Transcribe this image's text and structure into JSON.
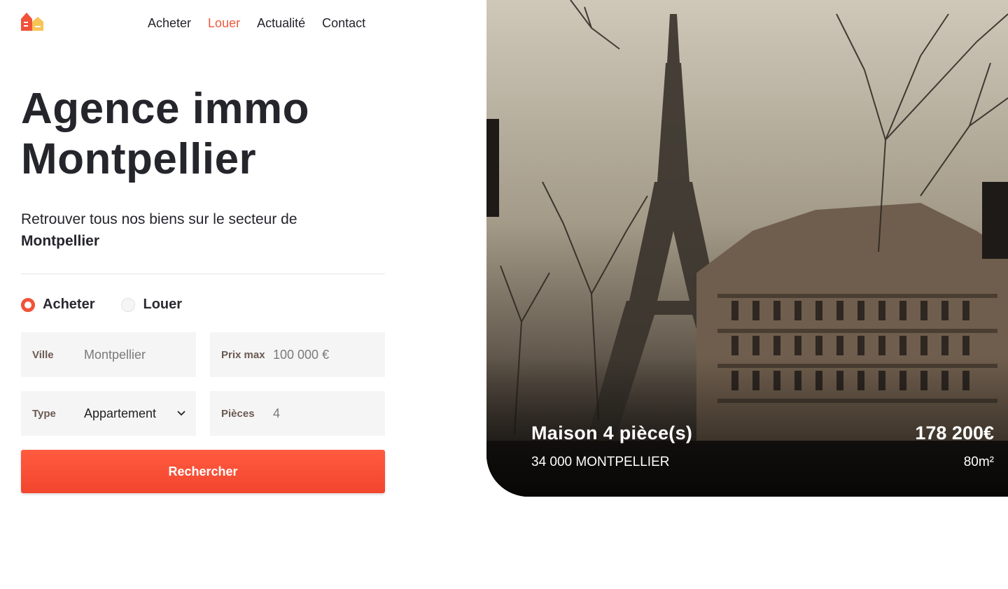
{
  "brand": {
    "logo_icon": "house-logo-icon",
    "accent": "#ee5a3e"
  },
  "nav": {
    "items": [
      {
        "label": "Acheter",
        "active": false
      },
      {
        "label": "Louer",
        "active": true
      },
      {
        "label": "Actualité",
        "active": false
      },
      {
        "label": "Contact",
        "active": false
      }
    ]
  },
  "hero": {
    "title_line1": "Agence immo",
    "title_line2": "Montpellier",
    "subtitle": "Retrouver tous nos biens sur le secteur de",
    "subtitle_strong": "Montpellier"
  },
  "search": {
    "mode_options": [
      {
        "label": "Acheter",
        "selected": true
      },
      {
        "label": "Louer",
        "selected": false
      }
    ],
    "ville": {
      "label": "Ville",
      "value": "Montpellier"
    },
    "prix": {
      "label": "Prix max",
      "value": "100 000 €"
    },
    "type": {
      "label": "Type",
      "value": "Appartement"
    },
    "pieces": {
      "label": "Pièces",
      "value": "4"
    },
    "submit_label": "Rechercher",
    "button_color": "#f54b33"
  },
  "listing": {
    "title": "Maison 4 pièce(s)",
    "location": "34 000 MONTPELLIER",
    "price": "178 200€",
    "area": "80m²"
  }
}
